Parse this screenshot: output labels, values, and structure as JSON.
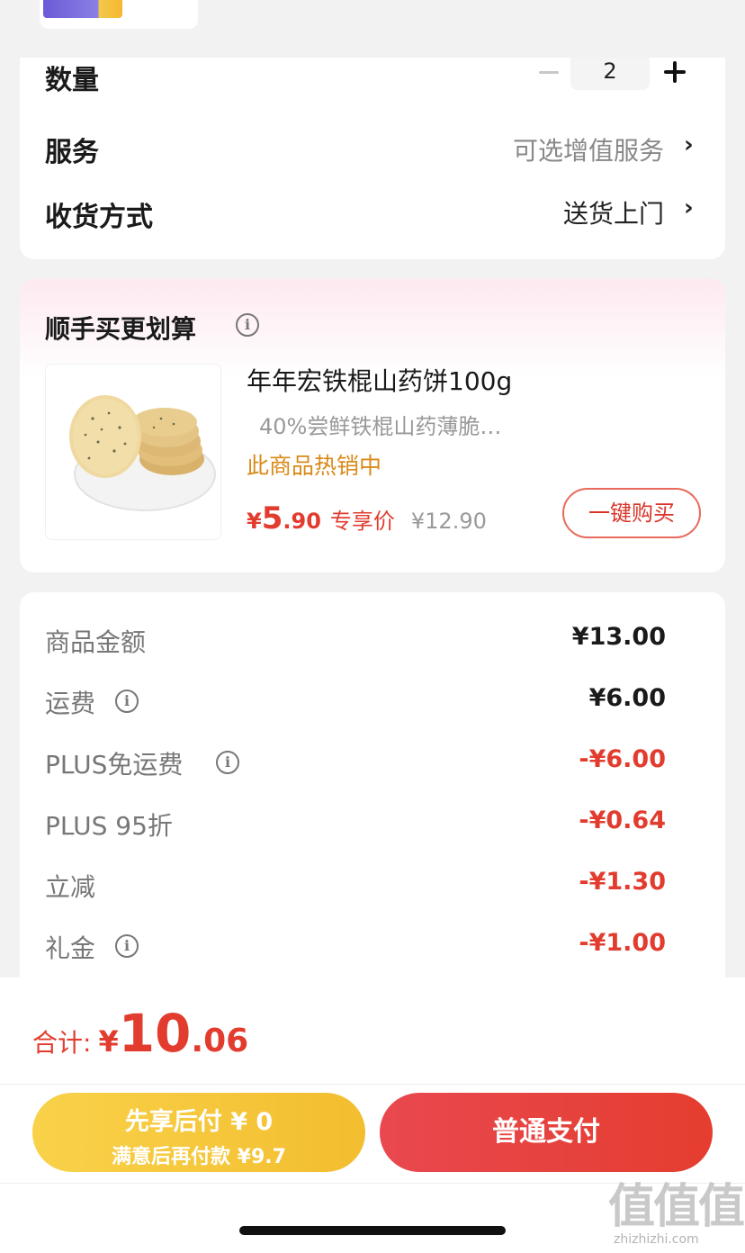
{
  "order": {
    "quantity_label": "数量",
    "quantity_value": "2",
    "service_label": "服务",
    "service_value": "可选增值服务",
    "delivery_label": "收货方式",
    "delivery_value": "送货上门"
  },
  "upsell": {
    "title": "顺手买更划算",
    "product": {
      "name": "年年宏铁棍山药饼100g",
      "subtitle": "40%尝鲜铁棍山药薄脆…",
      "hot_tag": "此商品热销中",
      "price_symbol": "¥",
      "price_int": "5",
      "price_dec": ".90",
      "price_tag": "专享价",
      "original_price": "¥12.90",
      "buy_button": "一键购买",
      "image_icon": "yam-crackers-image"
    }
  },
  "fees": [
    {
      "label": "商品金额",
      "value": "¥13.00",
      "info": false,
      "red": false
    },
    {
      "label": "运费",
      "value": "¥6.00",
      "info": true,
      "red": false
    },
    {
      "label": "PLUS免运费",
      "value": "-¥6.00",
      "info": true,
      "red": true
    },
    {
      "label": "PLUS 95折",
      "value": "-¥0.64",
      "info": false,
      "red": true
    },
    {
      "label": "立减",
      "value": "-¥1.30",
      "info": false,
      "red": true
    },
    {
      "label": "礼金",
      "value": "-¥1.00",
      "info": true,
      "red": true
    }
  ],
  "footer": {
    "total_label": "合计:",
    "total_symbol": "¥",
    "total_int": "10",
    "total_dec": ".06",
    "pay_later_line1": "先享后付 ¥ 0",
    "pay_later_line2": "满意后再付款 ¥9.7",
    "pay_normal": "普通支付",
    "watermark_main": "值值值",
    "watermark_url": "zhizhizhi.com"
  },
  "colors": {
    "accent_red": "#e23c2f",
    "gold": "#f3bd2f",
    "hot_orange": "#d98a1a"
  }
}
